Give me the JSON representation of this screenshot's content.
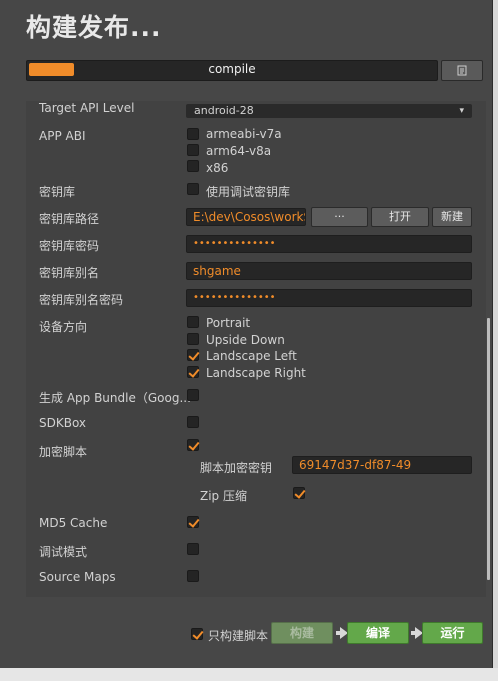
{
  "window": {
    "title": "构建发布...",
    "progress": {
      "label": "compile",
      "fraction": 0.11
    }
  },
  "settings": {
    "target_api_label": "Target API Level",
    "target_api_value": "android-28",
    "app_abi": {
      "label": "APP ABI",
      "options": [
        {
          "label": "armeabi-v7a",
          "checked": false
        },
        {
          "label": "arm64-v8a",
          "checked": false
        },
        {
          "label": "x86",
          "checked": false
        }
      ]
    },
    "keystore": {
      "label": "密钥库",
      "option": "使用调试密钥库",
      "checked": false
    },
    "keystore_path": {
      "label": "密钥库路径",
      "value": "E:\\dev\\Cosos\\workS",
      "btn_browse": "···",
      "btn_open": "打开",
      "btn_new": "新建"
    },
    "keystore_password": {
      "label": "密钥库密码",
      "value": "••••••••••••••"
    },
    "keystore_alias": {
      "label": "密钥库别名",
      "value": "shgame"
    },
    "alias_password": {
      "label": "密钥库别名密码",
      "value": "••••••••••••••"
    },
    "orientation": {
      "label": "设备方向",
      "options": [
        {
          "label": "Portrait",
          "checked": false
        },
        {
          "label": "Upside Down",
          "checked": false
        },
        {
          "label": "Landscape Left",
          "checked": true
        },
        {
          "label": "Landscape Right",
          "checked": true
        }
      ]
    },
    "app_bundle": {
      "label": "生成 App Bundle（Goog...",
      "checked": false
    },
    "sdkbox": {
      "label": "SDKBox",
      "checked": false
    },
    "encrypt_js": {
      "label": "加密脚本",
      "checked": true,
      "key_label": "脚本加密密钥",
      "key_value": "69147d37-df87-49",
      "zip_label": "Zip 压缩",
      "zip_checked": true
    },
    "md5_cache": {
      "label": "MD5 Cache",
      "checked": true
    },
    "debug_mode": {
      "label": "调试模式",
      "checked": false
    },
    "source_maps": {
      "label": "Source Maps",
      "checked": false
    }
  },
  "footer": {
    "only_build_script": {
      "label": "只构建脚本",
      "checked": true
    },
    "build": "构建",
    "compile": "编译",
    "run": "运行"
  },
  "colors": {
    "accent": "#f08c2a",
    "green": "#63a84a",
    "background": "#474747"
  }
}
